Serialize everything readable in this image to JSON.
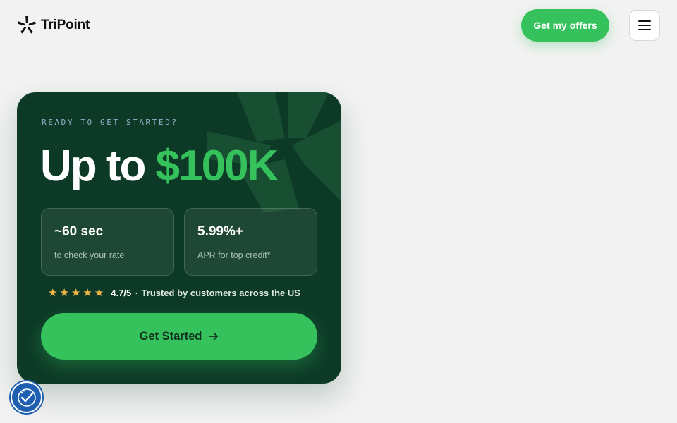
{
  "brand": {
    "name": "TriPoint",
    "logo_icon": "asterisk-logo-icon"
  },
  "header": {
    "cta_label": "Get my offers",
    "menu_icon": "hamburger-menu-icon"
  },
  "hero": {
    "eyebrow": "READY TO GET STARTED?",
    "headline_prefix": "Up to ",
    "headline_amount": "$100K",
    "stats": [
      {
        "value": "~60 sec",
        "label": "to check your rate"
      },
      {
        "value": "5.99%+",
        "label": "APR for top credit*"
      }
    ],
    "rating": {
      "stars": "★★★★★",
      "score": "4.7/5",
      "separator": "·",
      "text": "Trusted by customers across the US",
      "value": 4.7,
      "max": 5
    },
    "cta_label": "Get Started",
    "cta_icon": "arrow-right-icon"
  },
  "accessibility_widget": {
    "icon": "accessibility-icon"
  },
  "colors": {
    "accent_green": "#35c15b",
    "card_bg": "#0d3a27",
    "page_bg": "#f1f2f1",
    "star": "#f0b646",
    "eyebrow": "#8fb3c9"
  }
}
